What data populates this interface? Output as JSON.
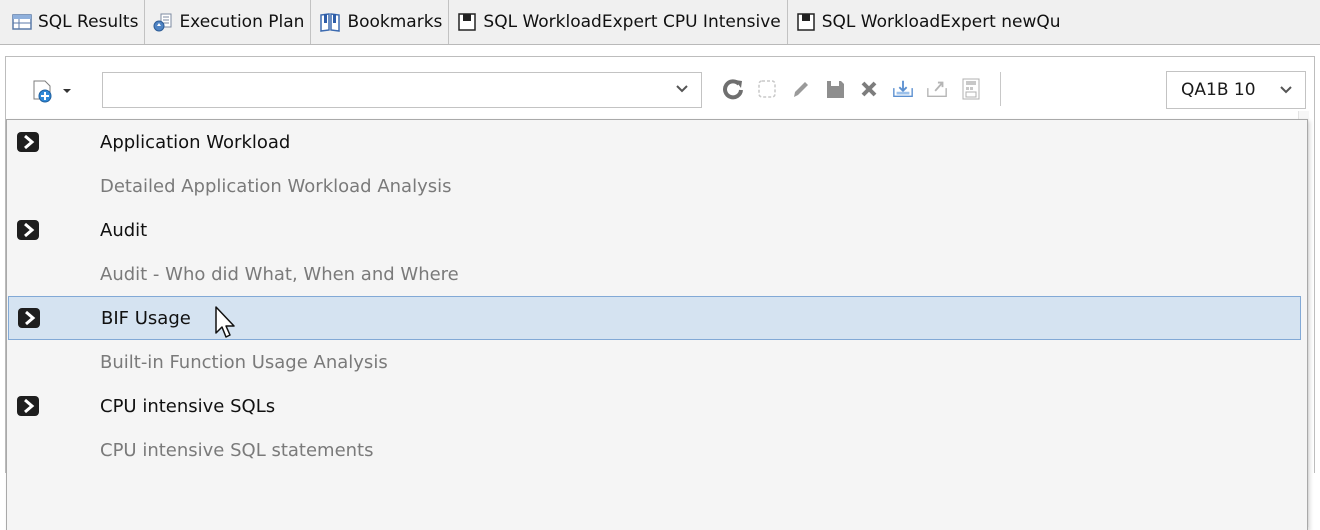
{
  "tabs": [
    {
      "label": "SQL Results",
      "icon": "table-icon"
    },
    {
      "label": "Execution Plan",
      "icon": "execution-plan-icon"
    },
    {
      "label": "Bookmarks",
      "icon": "bookmarks-icon"
    },
    {
      "label": "SQL WorkloadExpert CPU Intensive",
      "icon": "window-icon"
    },
    {
      "label": "SQL WorkloadExpert newQu",
      "icon": "window-icon"
    }
  ],
  "toolbar": {
    "query_combo_value": "",
    "server_select_value": "QA1B 10",
    "tool_icons": [
      "refresh-icon",
      "clear-icon",
      "edit-icon",
      "save-icon",
      "delete-icon",
      "import-icon",
      "export-icon",
      "sql-calculator-icon"
    ]
  },
  "dropdown": {
    "items": [
      {
        "title": "Application Workload",
        "description": "Detailed Application Workload Analysis",
        "selected": false
      },
      {
        "title": "Audit",
        "description": "Audit - Who did What, When and Where",
        "selected": false
      },
      {
        "title": "BIF Usage",
        "description": "Built-in Function Usage Analysis",
        "selected": true
      },
      {
        "title": "CPU intensive SQLs",
        "description": "CPU intensive SQL statements",
        "selected": false
      }
    ]
  },
  "colors": {
    "selection_fill": "#d5e3f1",
    "selection_border": "#82a9d6",
    "description_text": "#7a7a7a"
  }
}
